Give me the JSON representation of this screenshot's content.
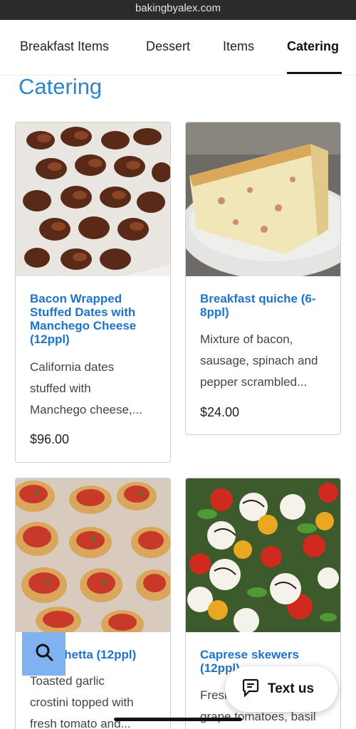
{
  "browser": {
    "url": "bakingbyalex.com"
  },
  "nav": {
    "tabs": [
      {
        "label": "Breakfast Items",
        "active": false
      },
      {
        "label": "Dessert",
        "active": false
      },
      {
        "label": "Items",
        "active": false
      },
      {
        "label": "Catering",
        "active": true
      }
    ]
  },
  "section": {
    "title": "Catering"
  },
  "products": [
    {
      "title": "Bacon Wrapped Stuffed Dates with Manchego Cheese (12ppl)",
      "description_lines": [
        "California dates",
        "stuffed with",
        "Manchego cheese,..."
      ],
      "price": "$96.00",
      "image": "bacon-wrapped-dates-photo"
    },
    {
      "title": "Breakfast quiche (6-8ppl)",
      "description_lines": [
        "Mixture of bacon,",
        "sausage, spinach and",
        "pepper scrambled..."
      ],
      "price": "$24.00",
      "image": "quiche-slice-photo"
    },
    {
      "title": "Bruschetta (12ppl)",
      "description_lines": [
        "Toasted garlic",
        "crostini topped with",
        "fresh tomato and..."
      ],
      "price": "",
      "image": "bruschetta-photo"
    },
    {
      "title": "Caprese skewers (12ppl)",
      "description_lines": [
        "Fresh",
        "grape tomatoes, basil"
      ],
      "price": "",
      "image": "caprese-skewers-photo"
    }
  ],
  "floating": {
    "search_icon": "search-icon",
    "chat_label": "Text us",
    "chat_icon": "chat-bubble-icon"
  },
  "colors": {
    "accent": "#2e86c9",
    "title_blue": "#1f74c7",
    "search_button": "#7fb2ef"
  }
}
